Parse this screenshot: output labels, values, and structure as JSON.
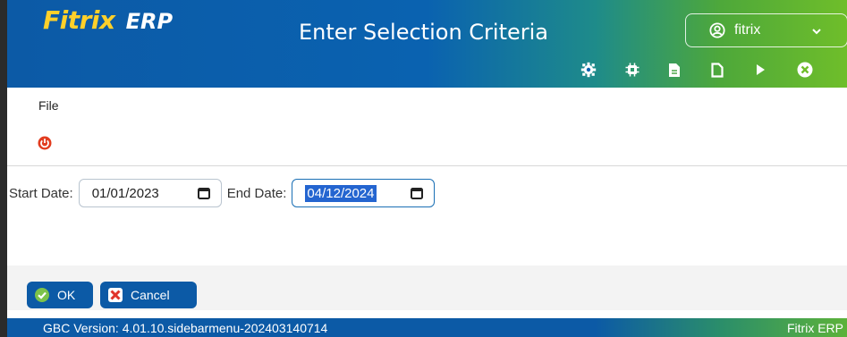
{
  "header": {
    "logo_fitrix": "Fitrix",
    "logo_erp": "ERP",
    "title": "Enter Selection Criteria",
    "user": {
      "name": "fitrix",
      "icon": "user-circle-icon",
      "dropdown_icon": "chevron-down-icon"
    }
  },
  "toolbar": {
    "icons": [
      "gear-icon",
      "chip-icon",
      "document-filled-icon",
      "document-outline-icon",
      "play-icon",
      "close-circle-icon"
    ]
  },
  "menubar": {
    "file_label": "File"
  },
  "actions": {
    "power_icon": "power-icon"
  },
  "form": {
    "start_label": "Start Date:",
    "start_value": "01/01/2023",
    "end_label": "End Date:",
    "end_value": "04/12/2024"
  },
  "buttons": {
    "ok_label": "OK",
    "cancel_label": "Cancel"
  },
  "status": {
    "version": "GBC Version: 4.01.10.sidebarmenu-202403140714",
    "brand": "Fitrix ERP"
  },
  "colors": {
    "primary": "#0c5aa6",
    "logo_yellow": "#ffd02a",
    "power_red": "#e23c1f",
    "ok_green": "#7cc24a",
    "cancel_red": "#e0342b"
  }
}
